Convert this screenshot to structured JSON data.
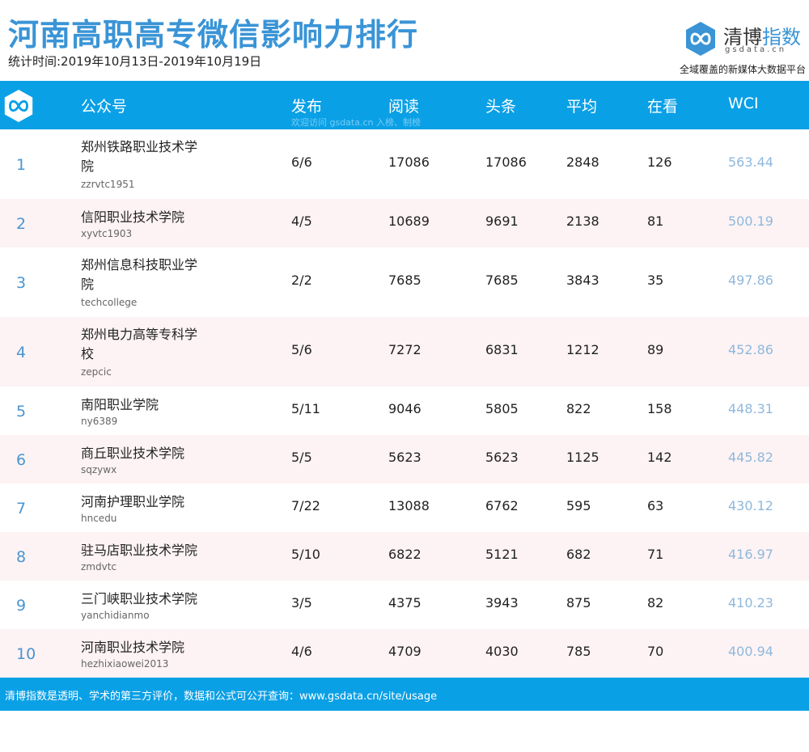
{
  "header": {
    "title": "河南高职高专微信影响力排行",
    "period": "统计时间:2019年10月13日-2019年10月19日"
  },
  "brand": {
    "name_prefix": "清博",
    "name_suffix": "指数",
    "domain": "gsdata.cn",
    "slogan": "全域覆盖的新媒体大数据平台",
    "logo_icon": "infinity-icon"
  },
  "table": {
    "columns": [
      "公众号",
      "发布",
      "阅读",
      "头条",
      "平均",
      "在看",
      "WCI"
    ],
    "watermark": "欢迎访问 gsdata.cn 入榜、制榜",
    "rows": [
      {
        "rank": "1",
        "name_line1": "郑州铁路职业技术学",
        "name_line2": "院",
        "id": "zzrvtc1951",
        "publish": "6/6",
        "read": "17086",
        "headline": "17086",
        "avg": "2848",
        "looking": "126",
        "wci": "563.44"
      },
      {
        "rank": "2",
        "name_line1": "信阳职业技术学院",
        "name_line2": "",
        "id": "xyvtc1903",
        "publish": "4/5",
        "read": "10689",
        "headline": "9691",
        "avg": "2138",
        "looking": "81",
        "wci": "500.19"
      },
      {
        "rank": "3",
        "name_line1": "郑州信息科技职业学",
        "name_line2": "院",
        "id": "techcollege",
        "publish": "2/2",
        "read": "7685",
        "headline": "7685",
        "avg": "3843",
        "looking": "35",
        "wci": "497.86"
      },
      {
        "rank": "4",
        "name_line1": "郑州电力高等专科学",
        "name_line2": "校",
        "id": "zepcic",
        "publish": "5/6",
        "read": "7272",
        "headline": "6831",
        "avg": "1212",
        "looking": "89",
        "wci": "452.86"
      },
      {
        "rank": "5",
        "name_line1": "南阳职业学院",
        "name_line2": "",
        "id": "ny6389",
        "publish": "5/11",
        "read": "9046",
        "headline": "5805",
        "avg": "822",
        "looking": "158",
        "wci": "448.31"
      },
      {
        "rank": "6",
        "name_line1": "商丘职业技术学院",
        "name_line2": "",
        "id": "sqzywx",
        "publish": "5/5",
        "read": "5623",
        "headline": "5623",
        "avg": "1125",
        "looking": "142",
        "wci": "445.82"
      },
      {
        "rank": "7",
        "name_line1": "河南护理职业学院",
        "name_line2": "",
        "id": "hncedu",
        "publish": "7/22",
        "read": "13088",
        "headline": "6762",
        "avg": "595",
        "looking": "63",
        "wci": "430.12"
      },
      {
        "rank": "8",
        "name_line1": "驻马店职业技术学院",
        "name_line2": "",
        "id": "zmdvtc",
        "publish": "5/10",
        "read": "6822",
        "headline": "5121",
        "avg": "682",
        "looking": "71",
        "wci": "416.97"
      },
      {
        "rank": "9",
        "name_line1": "三门峡职业技术学院",
        "name_line2": "",
        "id": "yanchidianmo",
        "publish": "3/5",
        "read": "4375",
        "headline": "3943",
        "avg": "875",
        "looking": "82",
        "wci": "410.23"
      },
      {
        "rank": "10",
        "name_line1": "河南职业技术学院",
        "name_line2": "",
        "id": "hezhixiaowei2013",
        "publish": "4/6",
        "read": "4709",
        "headline": "4030",
        "avg": "785",
        "looking": "70",
        "wci": "400.94"
      }
    ]
  },
  "footer": {
    "text": "清博指数是透明、学术的第三方评价，数据和公式可公开查询：www.gsdata.cn/site/usage"
  },
  "colors": {
    "accent": "#0aa0e6",
    "title": "#3a94d6",
    "rank": "#4a95d0",
    "wci": "#8fb8dc",
    "row_alt": "#fdf3f4"
  }
}
